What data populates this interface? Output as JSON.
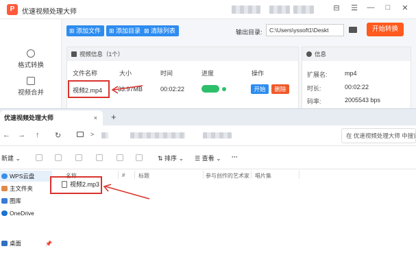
{
  "app": {
    "title": "优速视频处理大师",
    "logo_glyph": "P",
    "window_controls": [
      "⊟",
      "☰",
      "—",
      "□",
      "✕"
    ],
    "sidebar": [
      {
        "label": "格式转换",
        "icon": "format-convert-icon"
      },
      {
        "label": "视频合并",
        "icon": "video-merge-icon"
      }
    ],
    "toolbar": {
      "add_file": "添加文件",
      "add_folder": "添加目录",
      "clear_list": "清除列表"
    },
    "output": {
      "label": "输出目录:",
      "path": "C:\\Users\\yssoft1\\Deskt"
    },
    "start_button": "开始转换",
    "video_panel": {
      "title": "视频信息（1个）",
      "columns": [
        "文件名称",
        "大小",
        "时间",
        "进度",
        "操作"
      ],
      "rows": [
        {
          "name": "视频2.mp4",
          "size": "33.97MB",
          "duration": "00:02:22",
          "progress": 1.0,
          "start": "开始",
          "delete": "删除"
        }
      ]
    },
    "info_panel": {
      "title": "信息",
      "rows": [
        {
          "label": "扩展名:",
          "value": "mp4"
        },
        {
          "label": "时长:",
          "value": "00:02:22"
        },
        {
          "label": "码率:",
          "value": "2005543 bps"
        }
      ]
    },
    "colors": {
      "accent_blue": "#2d8cf0",
      "accent_orange": "#ff5a1f",
      "progress_green": "#2ebf6a",
      "highlight_red": "#d9322b"
    }
  },
  "explorer": {
    "tab_title": "优速视频处理大师",
    "tab_close": "×",
    "new_tab": "+",
    "nav": {
      "back": "←",
      "forward": "→",
      "up": "↑",
      "refresh": "↻",
      "breadcrumb_sep": ">",
      "search_placeholder": "在 优速视频处理大师 中搜索"
    },
    "commands": {
      "new": "新建",
      "sort": "排序",
      "view": "查看",
      "more": "···"
    },
    "nav_pane": [
      {
        "label": "WPS云盘",
        "icon": "cloud-icon",
        "selected": true
      },
      {
        "label": "主文件夹",
        "icon": "home-icon",
        "selected": false
      },
      {
        "label": "图库",
        "icon": "gallery-icon",
        "selected": false
      },
      {
        "label": "OneDrive",
        "icon": "onedrive-icon",
        "selected": false
      },
      {
        "label": "桌面",
        "icon": "desktop-icon",
        "selected": false
      }
    ],
    "columns": [
      "名称",
      "#",
      "标题",
      "参与创作的艺术家",
      "唱片集"
    ],
    "files": [
      {
        "name": "视频2.mp3",
        "icon": "audio-file-icon"
      }
    ]
  }
}
